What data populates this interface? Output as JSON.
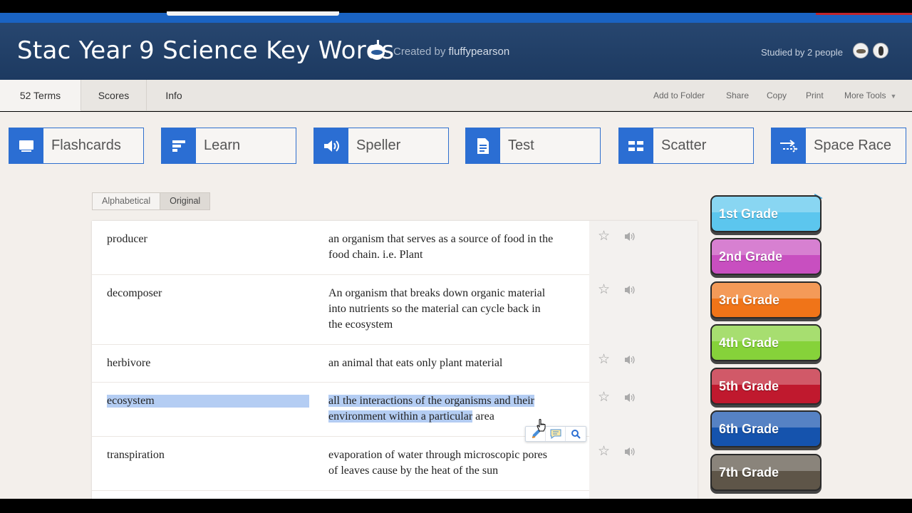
{
  "set": {
    "title": "Stac Year 9 Science Key Words",
    "created_prefix": "Created by",
    "creator": "fluffypearson",
    "studied": "Studied by 2 people"
  },
  "tabs": [
    {
      "label": "52 Terms",
      "active": true
    },
    {
      "label": "Scores",
      "active": false
    },
    {
      "label": "Info",
      "active": false
    }
  ],
  "tools": [
    "Add to Folder",
    "Share",
    "Copy",
    "Print",
    "More Tools"
  ],
  "modes": [
    {
      "label": "Flashcards",
      "icon": "cards-icon"
    },
    {
      "label": "Learn",
      "icon": "learn-icon"
    },
    {
      "label": "Speller",
      "icon": "speaker-icon"
    },
    {
      "label": "Test",
      "icon": "document-icon"
    },
    {
      "label": "Scatter",
      "icon": "scatter-icon"
    },
    {
      "label": "Space Race",
      "icon": "arrows-icon"
    }
  ],
  "sort": {
    "alphabetical": "Alphabetical",
    "original": "Original",
    "selected": "Original"
  },
  "terms": [
    {
      "term": "producer",
      "definition": "an organism that serves as a source of food in the food chain. i.e. Plant"
    },
    {
      "term": "decomposer",
      "definition": "An organism that breaks down organic material into nutrients so the material can cycle back in the ecosystem"
    },
    {
      "term": "herbivore",
      "definition": "an animal that eats only plant material"
    },
    {
      "term": "ecosystem",
      "definition_highlighted": "all the interactions of the organisms and their environment within a particular",
      "definition_rest": " area"
    },
    {
      "term": "transpiration",
      "definition": "evaporation of water through microscopic pores of leaves cause by the heat of the sun"
    }
  ],
  "ad": {
    "grades": [
      {
        "label": "1st Grade",
        "color": "#5cc6ee"
      },
      {
        "label": "2nd Grade",
        "color": "#c84fc0"
      },
      {
        "label": "3rd Grade",
        "color": "#f07418"
      },
      {
        "label": "4th Grade",
        "color": "#86d23a"
      },
      {
        "label": "5th Grade",
        "color": "#c0192e"
      },
      {
        "label": "6th Grade",
        "color": "#1553ad"
      },
      {
        "label": "7th Grade",
        "color": "#5e5548"
      }
    ]
  },
  "colors": {
    "accent": "#2b6ed3",
    "header": "#23416a",
    "highlight": "#b4cdf3"
  }
}
